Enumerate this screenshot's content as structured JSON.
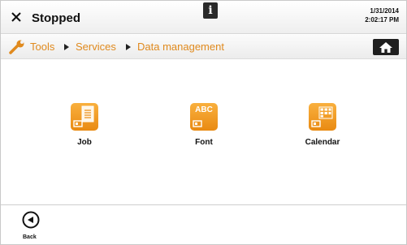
{
  "status": {
    "text": "Stopped",
    "date": "1/31/2014",
    "time": "2:02:17 PM"
  },
  "breadcrumb": {
    "items": [
      "Tools",
      "Services",
      "Data management"
    ]
  },
  "tiles": [
    {
      "label": "Job",
      "icon": "job-document-icon"
    },
    {
      "label": "Font",
      "icon": "font-abc-icon",
      "icon_text": "ABC"
    },
    {
      "label": "Calendar",
      "icon": "calendar-grid-icon"
    }
  ],
  "footer": {
    "back_label": "Back"
  },
  "colors": {
    "accent": "#f0961c",
    "breadcrumb": "#e08a1e",
    "dark": "#1f1f1f"
  }
}
